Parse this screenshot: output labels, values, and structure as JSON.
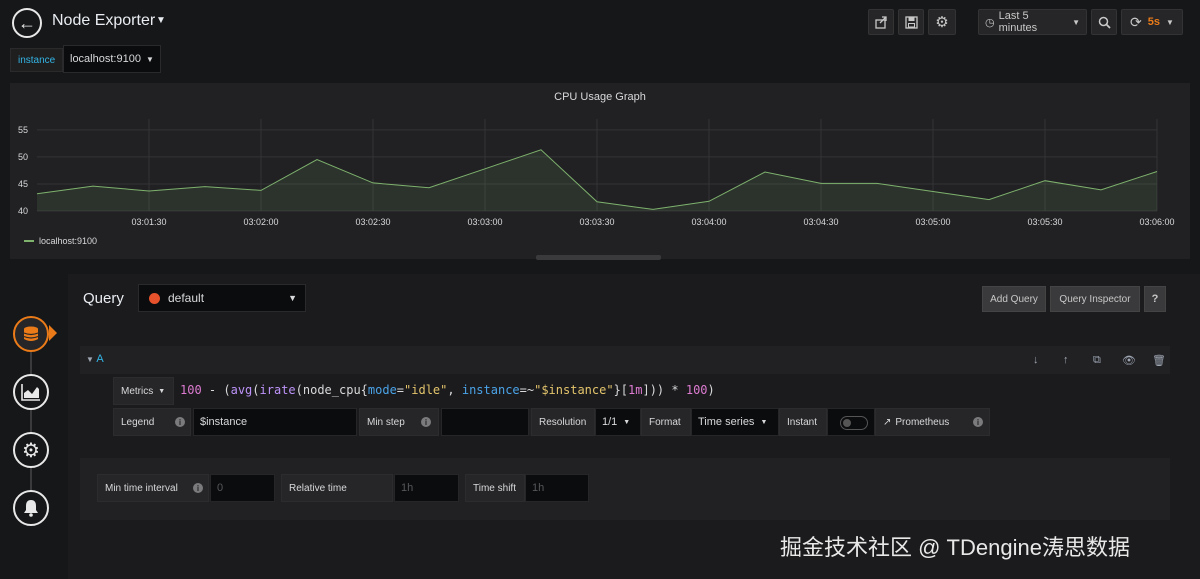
{
  "header": {
    "title": "Node Exporter",
    "time_range": "Last 5 minutes",
    "refresh_interval": "5s"
  },
  "variables": {
    "label": "instance",
    "value": "localhost:9100"
  },
  "panel": {
    "title": "CPU Usage Graph",
    "legend": "localhost:9100"
  },
  "chart_data": {
    "type": "area",
    "title": "CPU Usage Graph",
    "x": [
      "03:01:00",
      "03:01:15",
      "03:01:30",
      "03:01:45",
      "03:02:00",
      "03:02:15",
      "03:02:30",
      "03:02:45",
      "03:03:00",
      "03:03:15",
      "03:03:30",
      "03:03:45",
      "03:04:00",
      "03:04:15",
      "03:04:30",
      "03:04:45",
      "03:05:00",
      "03:05:15",
      "03:05:30",
      "03:05:45",
      "03:06:00"
    ],
    "x_ticks": [
      "03:01:30",
      "03:02:00",
      "03:02:30",
      "03:03:00",
      "03:03:30",
      "03:04:00",
      "03:04:30",
      "03:05:00",
      "03:05:30",
      "03:06:00"
    ],
    "y_ticks": [
      40,
      45,
      50,
      55
    ],
    "ylim": [
      40,
      57
    ],
    "series": [
      {
        "name": "localhost:9100",
        "color": "#7eb26d",
        "values": [
          43.2,
          44.6,
          43.7,
          44.5,
          43.8,
          49.5,
          45.2,
          44.3,
          47.8,
          51.3,
          41.7,
          40.3,
          41.8,
          47.2,
          45.1,
          45.1,
          43.6,
          42.1,
          45.6,
          43.9,
          47.3
        ]
      }
    ],
    "grid": true,
    "legend_position": "bottom-left"
  },
  "query": {
    "title": "Query",
    "datasource": "default",
    "add_query": "Add Query",
    "query_inspector": "Query Inspector",
    "help": "?"
  },
  "row": {
    "letter": "A",
    "metrics_label": "Metrics",
    "expression": {
      "p1": "100",
      "p2": " - (",
      "p3": "avg",
      "p4": "(",
      "p5": "irate",
      "p6": "(node_cpu{",
      "p7": "mode",
      "p8": "=",
      "p9": "\"idle\"",
      "p10": ", ",
      "p11": "instance",
      "p12": "=~",
      "p13": "\"$instance\"",
      "p14": "}[",
      "p15": "1m",
      "p16": "])) * ",
      "p17": "100",
      "p18": ")"
    },
    "legend_label": "Legend",
    "legend_value": "$instance",
    "min_step_label": "Min step",
    "resolution_label": "Resolution",
    "resolution_value": "1/1",
    "format_label": "Format",
    "format_value": "Time series",
    "instant_label": "Instant",
    "prometheus_link": "Prometheus"
  },
  "options": {
    "min_interval_label": "Min time interval",
    "min_interval_placeholder": "0",
    "relative_time_label": "Relative time",
    "relative_time_placeholder": "1h",
    "time_shift_label": "Time shift",
    "time_shift_placeholder": "1h"
  },
  "watermark": "掘金技术社区 @ TDengine涛思数据"
}
